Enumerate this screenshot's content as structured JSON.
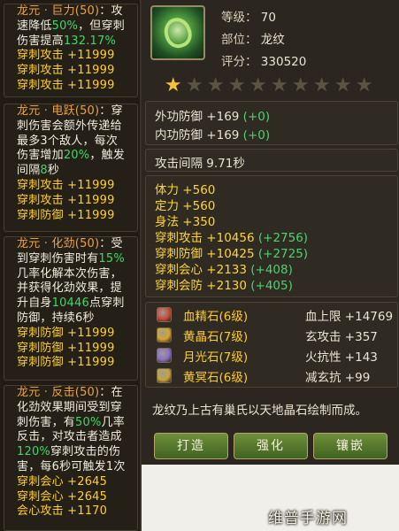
{
  "skills": [
    {
      "lines": [
        [
          {
            "t": "龙元 · 巨力(50)",
            "k": "nm"
          },
          {
            "t": "：攻",
            "k": "desc"
          }
        ],
        [
          {
            "t": "速降低",
            "k": "desc"
          },
          {
            "t": "50%",
            "k": "hl"
          },
          {
            "t": "，但穿刺",
            "k": "desc"
          }
        ],
        [
          {
            "t": "伤害提高",
            "k": "desc"
          },
          {
            "t": "132.17%",
            "k": "hl"
          }
        ],
        [
          {
            "t": "穿刺攻击 +11999",
            "k": "st"
          }
        ],
        [
          {
            "t": "穿刺攻击 +11999",
            "k": "st"
          }
        ],
        [
          {
            "t": "穿刺攻击 +11999",
            "k": "st"
          }
        ]
      ]
    },
    {
      "lines": [
        [
          {
            "t": "龙元 · 电跃(50)",
            "k": "nm"
          },
          {
            "t": "：穿",
            "k": "desc"
          }
        ],
        [
          {
            "t": "刺伤害会额外传递给",
            "k": "desc"
          }
        ],
        [
          {
            "t": "最多3个敌人，每次",
            "k": "desc"
          }
        ],
        [
          {
            "t": "伤害增加",
            "k": "desc"
          },
          {
            "t": "20%",
            "k": "hl"
          },
          {
            "t": "，触发",
            "k": "desc"
          }
        ],
        [
          {
            "t": "间隔",
            "k": "desc"
          },
          {
            "t": "8",
            "k": "hl"
          },
          {
            "t": "秒",
            "k": "desc"
          }
        ],
        [
          {
            "t": "穿刺攻击 +11999",
            "k": "st"
          }
        ],
        [
          {
            "t": "穿刺攻击 +11999",
            "k": "st"
          }
        ],
        [
          {
            "t": "穿刺防御 +11999",
            "k": "st"
          }
        ]
      ]
    },
    {
      "lines": [
        [
          {
            "t": "龙元 · 化劲(50)",
            "k": "nm"
          },
          {
            "t": "：受",
            "k": "desc"
          }
        ],
        [
          {
            "t": "到穿刺伤害时有",
            "k": "desc"
          },
          {
            "t": "15%",
            "k": "hl"
          }
        ],
        [
          {
            "t": "几率化解本次伤害，",
            "k": "desc"
          }
        ],
        [
          {
            "t": "并获得化劲效果，提",
            "k": "desc"
          }
        ],
        [
          {
            "t": "升自身",
            "k": "desc"
          },
          {
            "t": "10446",
            "k": "hl"
          },
          {
            "t": "点穿刺",
            "k": "desc"
          }
        ],
        [
          {
            "t": "防御，持续6秒",
            "k": "desc"
          }
        ],
        [
          {
            "t": "穿刺防御 +11999",
            "k": "st"
          }
        ],
        [
          {
            "t": "穿刺防御 +11999",
            "k": "st"
          }
        ],
        [
          {
            "t": "穿刺防御 +11999",
            "k": "st"
          }
        ]
      ]
    },
    {
      "lines": [
        [
          {
            "t": "龙元 · 反击(50)",
            "k": "nm"
          },
          {
            "t": "：在",
            "k": "desc"
          }
        ],
        [
          {
            "t": "化劲效果期间受到穿",
            "k": "desc"
          }
        ],
        [
          {
            "t": "刺伤害，有",
            "k": "desc"
          },
          {
            "t": "50%",
            "k": "hl"
          },
          {
            "t": "几率",
            "k": "desc"
          }
        ],
        [
          {
            "t": "反击，对攻击者造成",
            "k": "desc"
          }
        ],
        [
          {
            "t": "120%",
            "k": "hl"
          },
          {
            "t": "穿刺攻击的伤",
            "k": "desc"
          }
        ],
        [
          {
            "t": "害，每6秒可触发1次",
            "k": "desc"
          }
        ],
        [
          {
            "t": "穿刺会心 +2645",
            "k": "st"
          }
        ],
        [
          {
            "t": "穿刺会心 +2645",
            "k": "st"
          }
        ],
        [
          {
            "t": "会心攻击 +1170",
            "k": "st"
          }
        ]
      ]
    }
  ],
  "item": {
    "level_label": "等级：",
    "level": "70",
    "slot_label": "部位：",
    "slot": "龙纹",
    "score_label": "评分：",
    "score": "330520",
    "stars_total": 10,
    "stars_filled": 1
  },
  "defense": [
    {
      "label": "外功防御 +169",
      "bonus": "(+0)"
    },
    {
      "label": "内功防御 +169",
      "bonus": "(+0)"
    }
  ],
  "attack_interval": "攻击间隔 9.71秒",
  "base_stats": [
    "体力 +560",
    "定力 +560",
    "身法 +350"
  ],
  "pierce_stats": [
    {
      "label": "穿刺攻击 +10456",
      "bonus": "(+2756)"
    },
    {
      "label": "穿刺防御 +10425",
      "bonus": "(+2725)"
    },
    {
      "label": "穿刺会心 +2133",
      "bonus": "(+408)"
    },
    {
      "label": "穿刺会防 +2130",
      "bonus": "(+405)"
    }
  ],
  "gems": [
    {
      "name": "血精石(6级)",
      "stat": "血上限 +14769",
      "color": "#c94a3a"
    },
    {
      "name": "黄晶石(7级)",
      "stat": "玄攻击 +357",
      "color": "#d9a52c"
    },
    {
      "name": "月光石(7级)",
      "stat": "火抗性 +143",
      "color": "#8a6fc9"
    },
    {
      "name": "黄冥石(6级)",
      "stat": "减玄抗 +99",
      "color": "#c9a23a"
    }
  ],
  "lore": "龙纹乃上古有巢氏以天地晶石绘制而成。",
  "buttons": {
    "forge": "打造",
    "enhance": "强化",
    "inlay": "镶嵌"
  },
  "watermark": "维普手游网"
}
